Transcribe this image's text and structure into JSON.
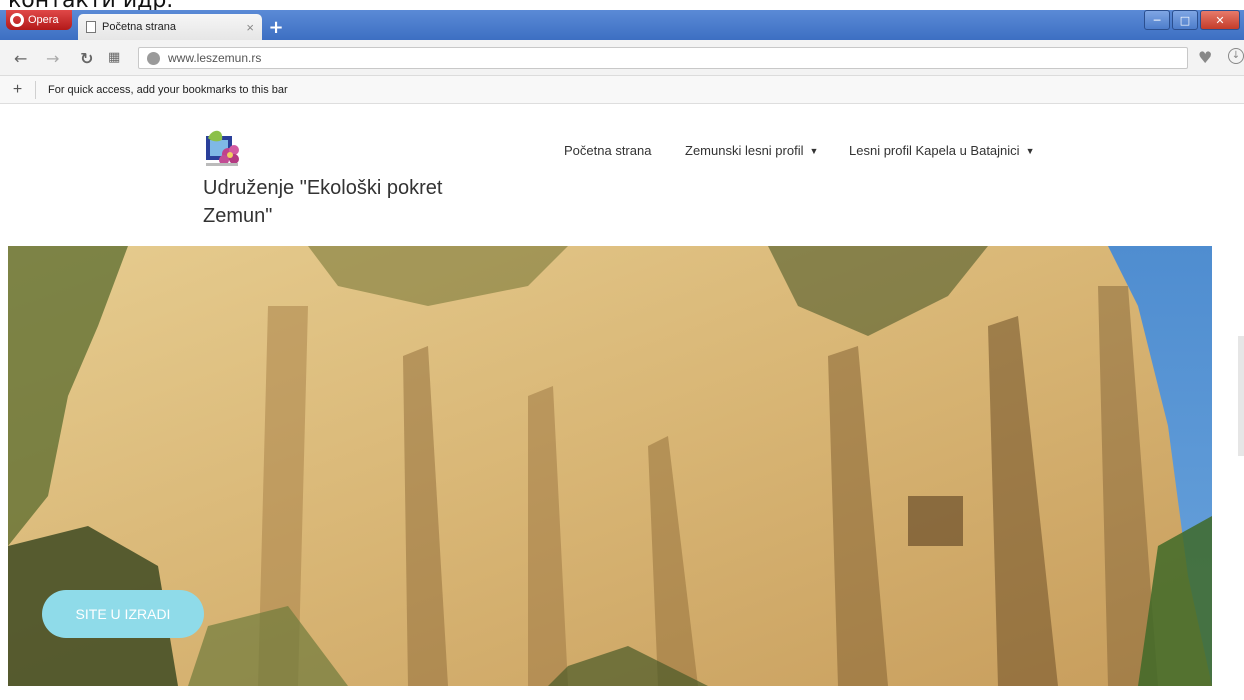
{
  "overflow_text": "контакти идр.",
  "browser": {
    "app_button": "Opera",
    "tab_title": "Početna strana",
    "tab_close": "×",
    "new_tab": "+",
    "url": "www.leszemun.rs",
    "bookmarks_add": "+",
    "bookmarks_hint": "For quick access, add your bookmarks to this bar",
    "icons": [
      "back-icon",
      "forward-icon",
      "reload-icon",
      "speed-dial-icon",
      "globe-icon",
      "heart-icon",
      "download-icon"
    ]
  },
  "site": {
    "org_name": "Udruženje \"Ekološki pokret Zemun\"",
    "nav": [
      {
        "label": "Početna strana",
        "has_dropdown": false
      },
      {
        "label": "Zemunski lesni profil",
        "has_dropdown": true
      },
      {
        "label": "Lesni profil Kapela u Batajnici",
        "has_dropdown": true
      }
    ],
    "hero_button": "SITE U IZRADI"
  },
  "colors": {
    "titlebar": "#4a7cc9",
    "cta": "#8fdbe9",
    "sky": "#5b95d3",
    "rock": "#d9b878"
  }
}
